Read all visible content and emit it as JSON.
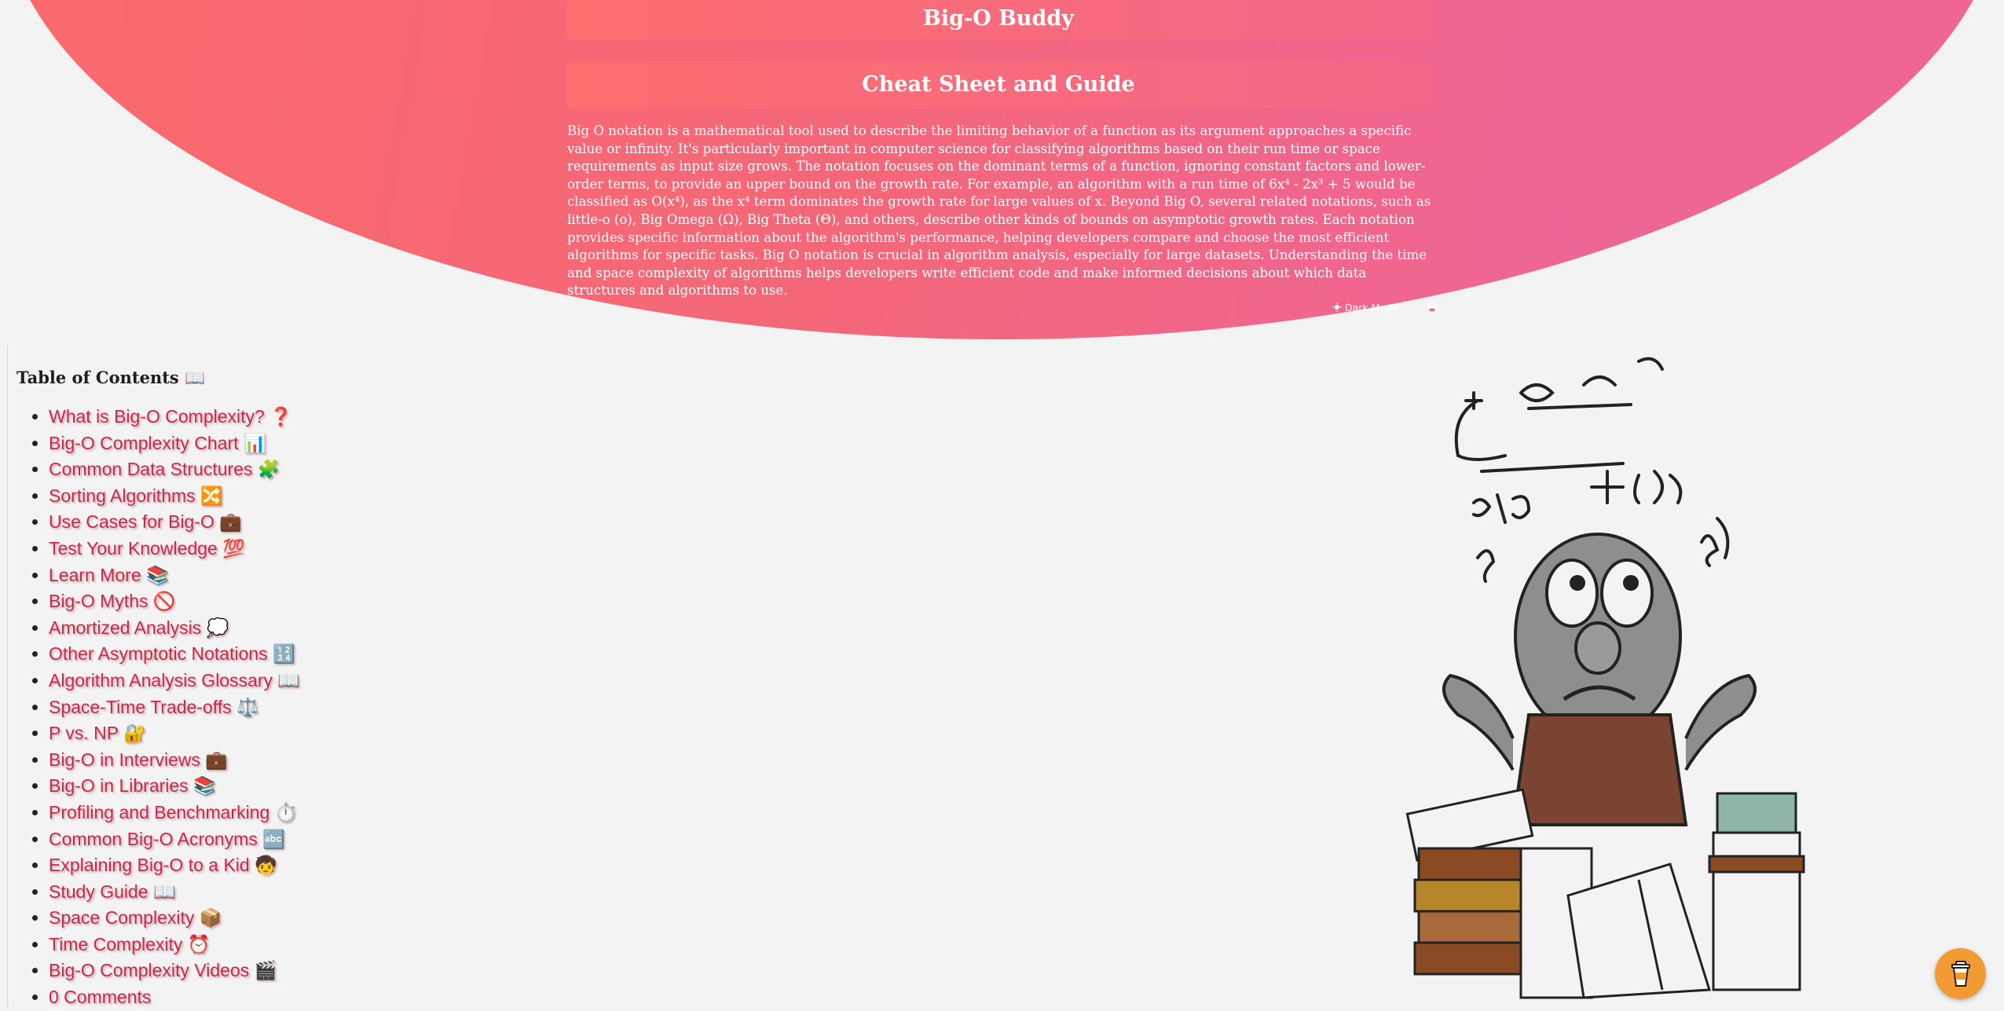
{
  "header": {
    "title": "Big-O Buddy",
    "subtitle": "Cheat Sheet and Guide",
    "intro": "Big O notation is a mathematical tool used to describe the limiting behavior of a function as its argument approaches a specific value or infinity. It's particularly important in computer science for classifying algorithms based on their run time or space requirements as input size grows. The notation focuses on the dominant terms of a function, ignoring constant factors and lower-order terms, to provide an upper bound on the growth rate. For example, an algorithm with a run time of 6x⁴ - 2x³ + 5 would be classified as O(x⁴), as the x⁴ term dominates the growth rate for large values of x. Beyond Big O, several related notations, such as little-o (o), Big Omega (Ω), Big Theta (Θ), and others, describe other kinds of bounds on asymptotic growth rates. Each notation provides specific information about the algorithm's performance, helping developers compare and choose the most efficient algorithms for specific tasks. Big O notation is crucial in algorithm analysis, especially for large datasets. Understanding the time and space complexity of algorithms helps developers write efficient code and make informed decisions about which data structures and algorithms to use.",
    "dark_mode_label": "Dark Mode",
    "dark_mode_icon": "sun-icon",
    "print_icon": "print-icon"
  },
  "toc": {
    "title": "Table of Contents 📖",
    "items": [
      {
        "label": "What is Big-O Complexity? ❓"
      },
      {
        "label": "Big-O Complexity Chart 📊"
      },
      {
        "label": "Common Data Structures 🧩"
      },
      {
        "label": "Sorting Algorithms 🔀"
      },
      {
        "label": "Use Cases for Big-O 💼"
      },
      {
        "label": "Test Your Knowledge 💯"
      },
      {
        "label": "Learn More 📚"
      },
      {
        "label": "Big-O Myths 🚫"
      },
      {
        "label": "Amortized Analysis 💭"
      },
      {
        "label": "Other Asymptotic Notations 🔢"
      },
      {
        "label": "Algorithm Analysis Glossary 📖"
      },
      {
        "label": "Space-Time Trade-offs ⚖️"
      },
      {
        "label": "P vs. NP 🔐"
      },
      {
        "label": "Big-O in Interviews 💼"
      },
      {
        "label": "Big-O in Libraries 📚"
      },
      {
        "label": "Profiling and Benchmarking ⏱️"
      },
      {
        "label": "Common Big-O Acronyms 🔤"
      },
      {
        "label": "Explaining Big-O to a Kid 🧒"
      },
      {
        "label": "Study Guide 📖"
      },
      {
        "label": "Space Complexity 📦"
      },
      {
        "label": "Time Complexity ⏰"
      },
      {
        "label": "Big-O Complexity Videos 🎬"
      },
      {
        "label": "0 Comments"
      }
    ]
  },
  "illustration": {
    "icon": "confused-student-illustration"
  },
  "support_button": {
    "icon": "coffee-cup-icon",
    "color": "#f29b32"
  },
  "colors": {
    "hero_start": "#fb6b6b",
    "hero_end": "#ee6696",
    "link": "#c8284c",
    "background": "#f3f3f3"
  }
}
